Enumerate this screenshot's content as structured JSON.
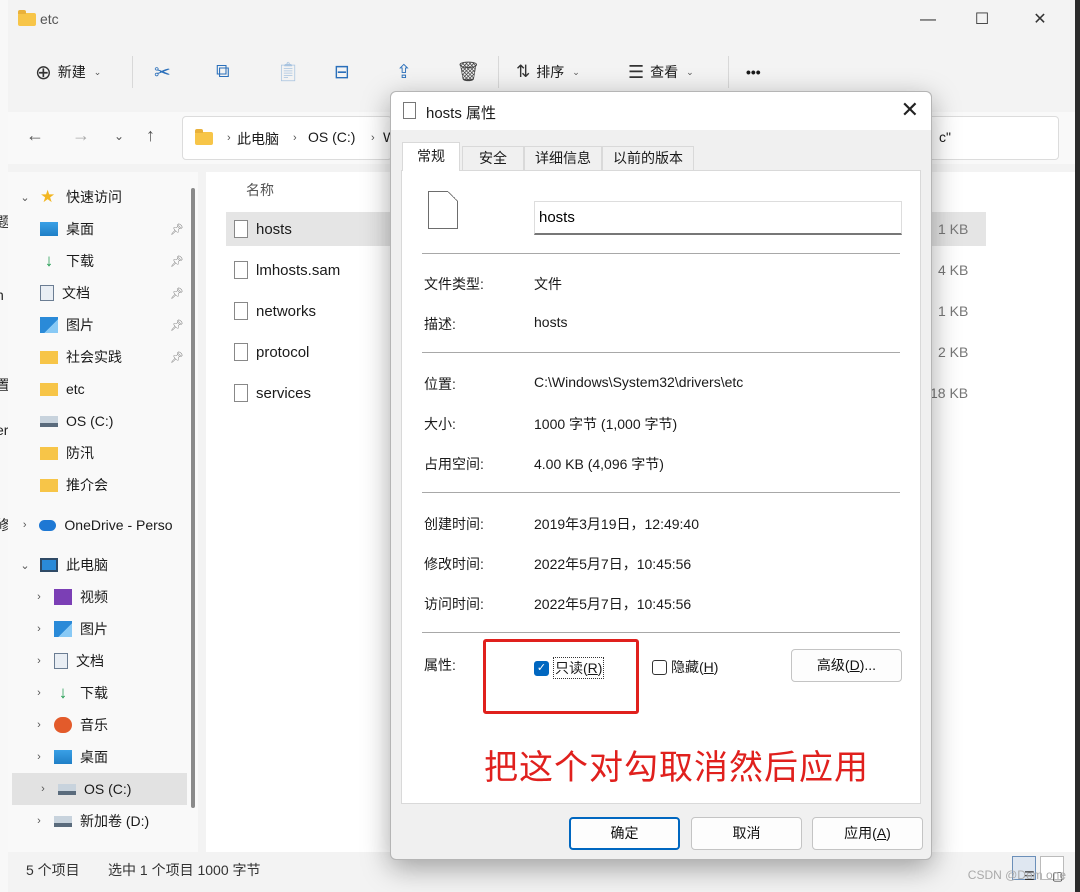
{
  "explorer": {
    "title": "etc",
    "left_edge_chars": [
      "题",
      "h",
      "置",
      "er",
      "修"
    ],
    "toolbar": {
      "new_label": "新建",
      "sort_label": "排序",
      "view_label": "查看",
      "more_label": "•••"
    },
    "address": {
      "crumbs": [
        "此电脑",
        "OS (C:)",
        "W"
      ],
      "search_tail": "c\""
    },
    "nav": {
      "quick_access": "快速访问",
      "quick_items": [
        "桌面",
        "下载",
        "文档",
        "图片",
        "社会实践",
        "etc",
        "OS (C:)",
        "防汛",
        "推介会"
      ],
      "onedrive": "OneDrive - Perso",
      "this_pc": "此电脑",
      "pc_items": [
        "视频",
        "图片",
        "文档",
        "下载",
        "音乐",
        "桌面",
        "OS (C:)",
        "新加卷 (D:)"
      ]
    },
    "files": {
      "column_name": "名称",
      "rows": [
        {
          "name": "hosts",
          "size": "1 KB"
        },
        {
          "name": "lmhosts.sam",
          "size": "4 KB"
        },
        {
          "name": "networks",
          "size": "1 KB"
        },
        {
          "name": "protocol",
          "size": "2 KB"
        },
        {
          "name": "services",
          "size": "18 KB"
        }
      ]
    },
    "status": {
      "count": "5 个项目",
      "selected": "选中 1 个项目  1000 字节"
    },
    "watermark": "CSDN @Dem  one"
  },
  "dialog": {
    "title": "hosts 属性",
    "tabs": [
      "常规",
      "安全",
      "详细信息",
      "以前的版本"
    ],
    "file_name": "hosts",
    "rows1": [
      {
        "label": "文件类型:",
        "value": "文件"
      },
      {
        "label": "描述:",
        "value": "hosts"
      }
    ],
    "rows2": [
      {
        "label": "位置:",
        "value": "C:\\Windows\\System32\\drivers\\etc"
      },
      {
        "label": "大小:",
        "value": "1000 字节 (1,000 字节)"
      },
      {
        "label": "占用空间:",
        "value": "4.00 KB (4,096 字节)"
      }
    ],
    "rows3": [
      {
        "label": "创建时间:",
        "value": "2019年3月19日，12:49:40"
      },
      {
        "label": "修改时间:",
        "value": "2022年5月7日，10:45:56"
      },
      {
        "label": "访问时间:",
        "value": "2022年5月7日，10:45:56"
      }
    ],
    "attributes_label": "属性:",
    "readonly": {
      "text": "只读(",
      "key": "R",
      "tail": ")",
      "checked": true
    },
    "hidden": {
      "text": "隐藏(",
      "key": "H",
      "tail": ")",
      "checked": false
    },
    "advanced": {
      "text": "高级(",
      "key": "D",
      "tail": ")..."
    },
    "annotation": "把这个对勾取消然后应用",
    "buttons": {
      "ok": "确定",
      "cancel": "取消",
      "apply_text": "应用(",
      "apply_key": "A",
      "apply_tail": ")"
    }
  },
  "colors": {
    "accent": "#0067c0",
    "annotation_red": "#e0201d",
    "folder_yellow": "#f7c548"
  }
}
